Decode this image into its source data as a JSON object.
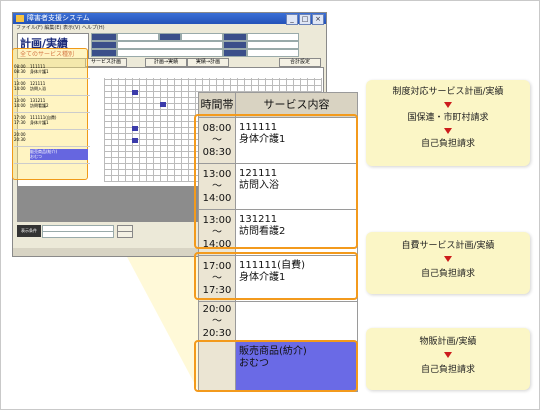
{
  "app": {
    "window_title": "障害者支援システム",
    "menu": "ファイル(F)  編集(E)  表示(V)  ヘルプ(H)",
    "heading_title": "計画/実績",
    "heading_sub": "全てのサービス種別",
    "tabs": [
      "サービス計画",
      "計画→実績",
      "実績→計画",
      "合計設定"
    ],
    "bottom_label": "表示条件",
    "mini_rows": [
      {
        "time": "08:00\n08:30",
        "service": "111111\n身体介護1"
      },
      {
        "time": "13:00\n14:00",
        "service": "121111\n訪問入浴"
      },
      {
        "time": "13:00\n14:00",
        "service": "131211\n訪問看護2"
      },
      {
        "time": "17:00\n17:30",
        "service": "111111(自費)\n身体介護1"
      },
      {
        "time": "20:00\n20:30",
        "service": ""
      },
      {
        "time": "",
        "service": "販売商品(紡介)\nおむつ"
      }
    ]
  },
  "zoom_table": {
    "header_time": "時間帯",
    "header_service": "サービス内容",
    "rows": [
      {
        "time_start": "08:00",
        "tilde": "～",
        "time_end": "08:30",
        "code": "111111",
        "name": "身体介護1"
      },
      {
        "time_start": "13:00",
        "tilde": "～",
        "time_end": "14:00",
        "code": "121111",
        "name": "訪問入浴"
      },
      {
        "time_start": "13:00",
        "tilde": "～",
        "time_end": "14:00",
        "code": "131211",
        "name": "訪問看護2"
      },
      {
        "time_start": "17:00",
        "tilde": "～",
        "time_end": "17:30",
        "code": "111111(自費)",
        "name": "身体介護1"
      },
      {
        "time_start": "20:00",
        "tilde": "～",
        "time_end": "20:30",
        "code": "",
        "name": ""
      },
      {
        "time_start": "",
        "tilde": "",
        "time_end": "",
        "code": "販売商品(紡介)",
        "name": "おむつ"
      }
    ]
  },
  "callouts": [
    {
      "lines": [
        "制度対応サービス計画/実績",
        "国保連・市町村請求",
        "自己負担請求"
      ]
    },
    {
      "lines": [
        "自費サービス計画/実績",
        "自己負担請求"
      ]
    },
    {
      "lines": [
        "物販計画/実績",
        "自己負担請求"
      ]
    }
  ],
  "colors": {
    "highlight": "#f39a1c",
    "callout_bg": "#fbf6c6",
    "arrow": "#cc1c1c",
    "blue_row": "#6a6ae6"
  }
}
